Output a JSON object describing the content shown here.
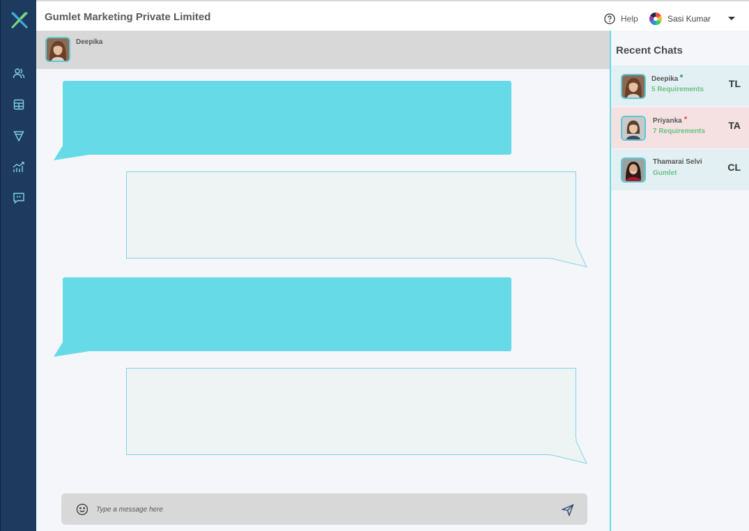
{
  "header": {
    "company": "Gumlet Marketing Private Limited",
    "help_label": "Help",
    "user_name": "Sasi Kumar"
  },
  "sidebar": {
    "items": [
      {
        "icon": "users-icon"
      },
      {
        "icon": "table-icon"
      },
      {
        "icon": "filter-icon"
      },
      {
        "icon": "analytics-icon"
      },
      {
        "icon": "chat-quote-icon"
      }
    ]
  },
  "chat": {
    "contact_name": "Deepika",
    "input_placeholder": "Type a message here"
  },
  "recent": {
    "title": "Recent Chats",
    "items": [
      {
        "name": "Deepika",
        "sub": "5 Requirements",
        "tag": "TL",
        "status_color": "#3bb273",
        "bg": "#e3f0f3"
      },
      {
        "name": "Priyanka",
        "sub": "7 Requirements",
        "tag": "TA",
        "status_color": "#f06b6b",
        "bg": "#f5e1e1"
      },
      {
        "name": "Thamarai Selvi",
        "sub": "Gumlet",
        "tag": "CL",
        "status_color": "",
        "bg": "#e3f0f3"
      }
    ]
  },
  "colors": {
    "sidebar": "#1f3a5f",
    "accent": "#66dae6",
    "online": "#3bb273",
    "offline": "#f06b6b"
  }
}
